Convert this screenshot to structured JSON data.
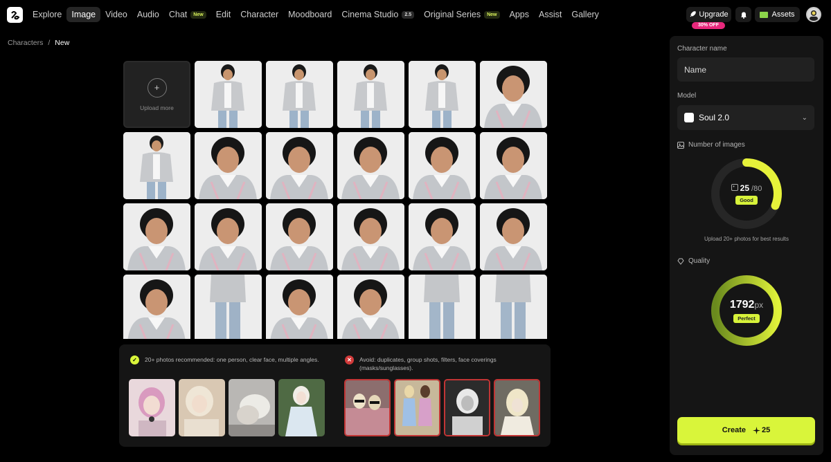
{
  "nav": {
    "items": [
      {
        "label": "Explore"
      },
      {
        "label": "Image",
        "active": true
      },
      {
        "label": "Video"
      },
      {
        "label": "Audio"
      },
      {
        "label": "Chat",
        "badge": "New"
      },
      {
        "label": "Edit"
      },
      {
        "label": "Character"
      },
      {
        "label": "Moodboard"
      },
      {
        "label": "Cinema Studio",
        "badge": "2.5"
      },
      {
        "label": "Original Series",
        "badge": "New"
      },
      {
        "label": "Apps"
      },
      {
        "label": "Assist"
      },
      {
        "label": "Gallery"
      }
    ],
    "upgrade_label": "Upgrade",
    "discount_label": "30% OFF",
    "assets_label": "Assets"
  },
  "breadcrumb": {
    "parent": "Characters",
    "separator": "/",
    "current": "New"
  },
  "upload": {
    "label": "Upload more"
  },
  "tips": {
    "good": "20+ photos recommended: one person, clear face, multiple angles.",
    "bad": "Avoid: duplicates, group shots, filters, face coverings (masks/sunglasses)."
  },
  "side": {
    "character_name_label": "Character name",
    "name_placeholder": "Name",
    "model_label": "Model",
    "model_value": "Soul 2.0",
    "images_label": "Number of images",
    "images_count": "25",
    "images_total": "/80",
    "images_progress": 0.3125,
    "images_status": "Good",
    "images_hint": "Upload 20+ photos for best results",
    "quality_label": "Quality",
    "quality_value": "1792",
    "quality_unit": "px",
    "quality_progress": 1.0,
    "quality_status": "Perfect",
    "create_label": "Create",
    "create_cost": "25"
  },
  "colors": {
    "accent": "#d9f53a",
    "background": "#000000",
    "panel": "#151515",
    "bad": "#c23535",
    "badge_pink": "#e8287c"
  }
}
